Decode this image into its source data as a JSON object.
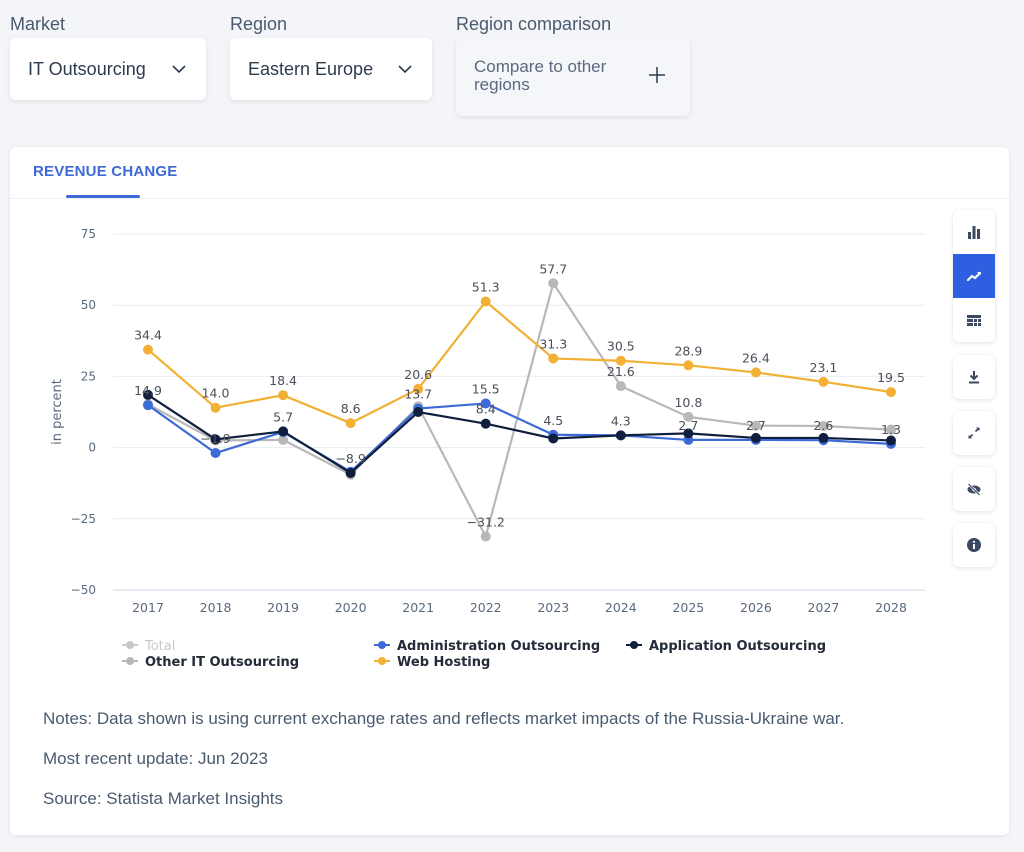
{
  "filters": {
    "market": {
      "label": "Market",
      "value": "IT Outsourcing"
    },
    "region": {
      "label": "Region",
      "value": "Eastern Europe"
    },
    "comparison": {
      "label": "Region comparison",
      "value": "Compare to other regions"
    }
  },
  "card": {
    "tab_label": "REVENUE CHANGE",
    "toolbar": [
      {
        "name": "bar-chart-icon",
        "active": false
      },
      {
        "name": "line-chart-icon",
        "active": true
      },
      {
        "name": "table-icon",
        "active": false
      },
      {
        "name": "download-icon",
        "active": false
      },
      {
        "name": "expand-icon",
        "active": false
      },
      {
        "name": "hide-icon",
        "active": false
      },
      {
        "name": "info-icon",
        "active": false
      }
    ],
    "notes": "Notes: Data shown is using current exchange rates and reflects market impacts of the Russia-Ukraine war.",
    "update": "Most recent update: Jun 2023",
    "source": "Source: Statista Market Insights"
  },
  "chart_data": {
    "type": "line",
    "title": "REVENUE CHANGE",
    "xlabel": "",
    "ylabel": "in percent",
    "ylim": [
      -50,
      75
    ],
    "yticks": [
      75,
      50,
      25,
      0,
      -25,
      -50
    ],
    "ytick_labels": [
      "75",
      "50",
      "25",
      "0",
      "−25",
      "−50"
    ],
    "grid": true,
    "legend_position": "bottom",
    "x": [
      "2017",
      "2018",
      "2019",
      "2020",
      "2021",
      "2022",
      "2023",
      "2024",
      "2025",
      "2026",
      "2027",
      "2028"
    ],
    "series": [
      {
        "name": "Total",
        "color": "#c8c8c8",
        "hidden": true,
        "values": []
      },
      {
        "name": "Other IT Outsourcing",
        "color": "#b8b8b8",
        "hidden": false,
        "values": [
          15.2,
          2.5,
          2.7,
          -9.5,
          14.5,
          -31.2,
          57.7,
          21.6,
          10.8,
          7.7,
          7.6,
          6.3
        ]
      },
      {
        "name": "Web Hosting",
        "color": "#f2b135",
        "hidden": false,
        "values": [
          34.4,
          14.0,
          18.4,
          8.6,
          20.6,
          51.3,
          31.3,
          30.5,
          28.9,
          26.4,
          23.1,
          19.5
        ]
      },
      {
        "name": "Administration Outsourcing",
        "color": "#3d6ad6",
        "hidden": false,
        "values": [
          14.9,
          -1.9,
          5.5,
          -8.5,
          13.7,
          15.5,
          4.5,
          4.3,
          2.7,
          2.7,
          2.6,
          1.3
        ]
      },
      {
        "name": "Application Outsourcing",
        "color": "#0f1f3d",
        "hidden": false,
        "values": [
          18.5,
          2.9,
          5.7,
          -8.9,
          12.5,
          8.4,
          3.2,
          4.3,
          5.0,
          3.4,
          3.4,
          2.5
        ]
      }
    ],
    "data_labels": [
      {
        "x": "2017",
        "y": 34.4,
        "text": "34.4"
      },
      {
        "x": "2017",
        "y": 14.9,
        "text": "14.9"
      },
      {
        "x": "2018",
        "y": 14.0,
        "text": "14.0"
      },
      {
        "x": "2018",
        "y": -1.9,
        "text": "−1.9"
      },
      {
        "x": "2019",
        "y": 18.4,
        "text": "18.4"
      },
      {
        "x": "2019",
        "y": 5.7,
        "text": "5.7"
      },
      {
        "x": "2020",
        "y": 8.6,
        "text": "8.6"
      },
      {
        "x": "2020",
        "y": -8.9,
        "text": "−8.9"
      },
      {
        "x": "2021",
        "y": 20.6,
        "text": "20.6"
      },
      {
        "x": "2021",
        "y": 13.7,
        "text": "13.7"
      },
      {
        "x": "2022",
        "y": 51.3,
        "text": "51.3"
      },
      {
        "x": "2022",
        "y": 15.5,
        "text": "15.5"
      },
      {
        "x": "2022",
        "y": 8.4,
        "text": "8.4"
      },
      {
        "x": "2022",
        "y": -31.2,
        "text": "−31.2"
      },
      {
        "x": "2023",
        "y": 57.7,
        "text": "57.7"
      },
      {
        "x": "2023",
        "y": 31.3,
        "text": "31.3"
      },
      {
        "x": "2023",
        "y": 4.5,
        "text": "4.5"
      },
      {
        "x": "2024",
        "y": 30.5,
        "text": "30.5"
      },
      {
        "x": "2024",
        "y": 21.6,
        "text": "21.6"
      },
      {
        "x": "2024",
        "y": 4.3,
        "text": "4.3"
      },
      {
        "x": "2025",
        "y": 28.9,
        "text": "28.9"
      },
      {
        "x": "2025",
        "y": 10.8,
        "text": "10.8"
      },
      {
        "x": "2025",
        "y": 2.7,
        "text": "2.7"
      },
      {
        "x": "2026",
        "y": 26.4,
        "text": "26.4"
      },
      {
        "x": "2026",
        "y": 2.7,
        "text": "2.7"
      },
      {
        "x": "2027",
        "y": 23.1,
        "text": "23.1"
      },
      {
        "x": "2027",
        "y": 2.6,
        "text": "2.6"
      },
      {
        "x": "2028",
        "y": 19.5,
        "text": "19.5"
      },
      {
        "x": "2028",
        "y": 1.3,
        "text": "1.3"
      }
    ],
    "legend": [
      {
        "name": "Total",
        "color": "#c8c8c8",
        "disabled": true
      },
      {
        "name": "Administration Outsourcing",
        "color": "#3d6ad6",
        "disabled": false
      },
      {
        "name": "Application Outsourcing",
        "color": "#0f1f3d",
        "disabled": false
      },
      {
        "name": "Other IT Outsourcing",
        "color": "#b8b8b8",
        "disabled": false
      },
      {
        "name": "Web Hosting",
        "color": "#f2b135",
        "disabled": false
      }
    ]
  }
}
